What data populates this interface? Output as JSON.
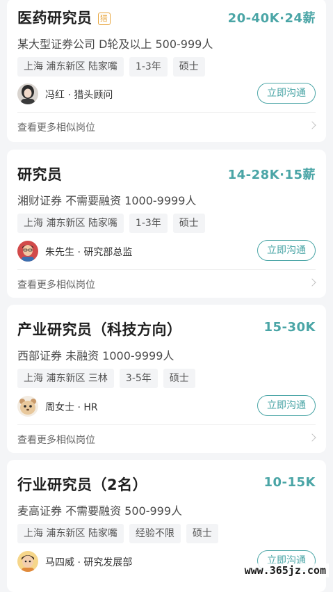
{
  "chat_label": "立即沟通",
  "more_label": "查看更多相似岗位",
  "hunt_badge": "猎",
  "watermark": "www.365jz.com",
  "jobs": [
    {
      "title": "医药研究员",
      "salary": "20-40K·24薪",
      "company": "某大型证券公司 D轮及以上 500-999人",
      "tags": [
        "上海 浦东新区 陆家嘴",
        "1-3年",
        "硕士"
      ],
      "recruiter": "冯红 · 猎头顾问",
      "headhunter": true
    },
    {
      "title": "研究员",
      "salary": "14-28K·15薪",
      "company": "湘财证券 不需要融资 1000-9999人",
      "tags": [
        "上海 浦东新区 陆家嘴",
        "1-3年",
        "硕士"
      ],
      "recruiter": "朱先生 · 研究部总监"
    },
    {
      "title": "产业研究员（科技方向）",
      "salary": "15-30K",
      "company": "西部证券 未融资 1000-9999人",
      "tags": [
        "上海 浦东新区 三林",
        "3-5年",
        "硕士"
      ],
      "recruiter": "周女士 · HR"
    },
    {
      "title": "行业研究员（2名）",
      "salary": "10-15K",
      "company": "麦高证券 不需要融资 500-999人",
      "tags": [
        "上海 浦东新区 陆家嘴",
        "经验不限",
        "硕士"
      ],
      "recruiter": "马四威 · 研究发展部"
    }
  ]
}
